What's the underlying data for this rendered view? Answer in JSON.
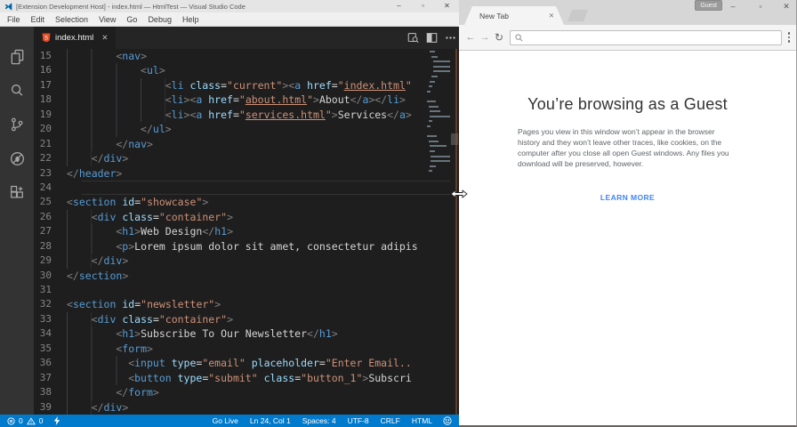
{
  "vscode": {
    "titlebar": {
      "title": "[Extension Development Host] - index.html — HtmlTest — Visual Studio Code",
      "minimize": "–",
      "maximize": "▫",
      "close": "✕"
    },
    "menubar": {
      "items": [
        "File",
        "Edit",
        "Selection",
        "View",
        "Go",
        "Debug",
        "Help"
      ]
    },
    "activitybar": {
      "items": [
        "explorer",
        "search",
        "source-control",
        "debug",
        "extensions"
      ]
    },
    "tab": {
      "label": "index.html",
      "close": "✕"
    },
    "editor": {
      "current_line": 24,
      "lines": [
        {
          "n": 15,
          "indent": 8,
          "tokens": [
            [
              "pt",
              "<"
            ],
            [
              "tg",
              "nav"
            ],
            [
              "pt",
              ">"
            ]
          ]
        },
        {
          "n": 16,
          "indent": 12,
          "tokens": [
            [
              "pt",
              "<"
            ],
            [
              "tg",
              "ul"
            ],
            [
              "pt",
              ">"
            ]
          ]
        },
        {
          "n": 17,
          "indent": 16,
          "tokens": [
            [
              "pt",
              "<"
            ],
            [
              "tg",
              "li"
            ],
            [
              "tx",
              " "
            ],
            [
              "at",
              "class"
            ],
            [
              "eq",
              "="
            ],
            [
              "st",
              "\"current\""
            ],
            [
              "pt",
              "><"
            ],
            [
              "tg",
              "a"
            ],
            [
              "tx",
              " "
            ],
            [
              "at",
              "href"
            ],
            [
              "eq",
              "="
            ],
            [
              "st",
              "\""
            ],
            [
              "ln",
              "index.html"
            ],
            [
              "st",
              "\""
            ]
          ]
        },
        {
          "n": 18,
          "indent": 16,
          "tokens": [
            [
              "pt",
              "<"
            ],
            [
              "tg",
              "li"
            ],
            [
              "pt",
              "><"
            ],
            [
              "tg",
              "a"
            ],
            [
              "tx",
              " "
            ],
            [
              "at",
              "href"
            ],
            [
              "eq",
              "="
            ],
            [
              "st",
              "\""
            ],
            [
              "ln",
              "about.html"
            ],
            [
              "st",
              "\""
            ],
            [
              "pt",
              ">"
            ],
            [
              "tx",
              "About"
            ],
            [
              "pt",
              "</"
            ],
            [
              "tg",
              "a"
            ],
            [
              "pt",
              "></"
            ],
            [
              "tg",
              "li"
            ],
            [
              "pt",
              ">"
            ]
          ]
        },
        {
          "n": 19,
          "indent": 16,
          "tokens": [
            [
              "pt",
              "<"
            ],
            [
              "tg",
              "li"
            ],
            [
              "pt",
              "><"
            ],
            [
              "tg",
              "a"
            ],
            [
              "tx",
              " "
            ],
            [
              "at",
              "href"
            ],
            [
              "eq",
              "="
            ],
            [
              "st",
              "\""
            ],
            [
              "ln",
              "services.html"
            ],
            [
              "st",
              "\""
            ],
            [
              "pt",
              ">"
            ],
            [
              "tx",
              "Services"
            ],
            [
              "pt",
              "</"
            ],
            [
              "tg",
              "a"
            ],
            [
              "pt",
              ">"
            ]
          ]
        },
        {
          "n": 20,
          "indent": 12,
          "tokens": [
            [
              "pt",
              "</"
            ],
            [
              "tg",
              "ul"
            ],
            [
              "pt",
              ">"
            ]
          ]
        },
        {
          "n": 21,
          "indent": 8,
          "tokens": [
            [
              "pt",
              "</"
            ],
            [
              "tg",
              "nav"
            ],
            [
              "pt",
              ">"
            ]
          ]
        },
        {
          "n": 22,
          "indent": 4,
          "tokens": [
            [
              "pt",
              "</"
            ],
            [
              "tg",
              "div"
            ],
            [
              "pt",
              ">"
            ]
          ]
        },
        {
          "n": 23,
          "indent": 0,
          "tokens": [
            [
              "pt",
              "</"
            ],
            [
              "tg",
              "header"
            ],
            [
              "pt",
              ">"
            ]
          ]
        },
        {
          "n": 24,
          "indent": 0,
          "tokens": []
        },
        {
          "n": 25,
          "indent": 0,
          "tokens": [
            [
              "pt",
              "<"
            ],
            [
              "tg",
              "section"
            ],
            [
              "tx",
              " "
            ],
            [
              "at",
              "id"
            ],
            [
              "eq",
              "="
            ],
            [
              "st",
              "\"showcase\""
            ],
            [
              "pt",
              ">"
            ]
          ]
        },
        {
          "n": 26,
          "indent": 4,
          "tokens": [
            [
              "pt",
              "<"
            ],
            [
              "tg",
              "div"
            ],
            [
              "tx",
              " "
            ],
            [
              "at",
              "class"
            ],
            [
              "eq",
              "="
            ],
            [
              "st",
              "\"container\""
            ],
            [
              "pt",
              ">"
            ]
          ]
        },
        {
          "n": 27,
          "indent": 8,
          "tokens": [
            [
              "pt",
              "<"
            ],
            [
              "tg",
              "h1"
            ],
            [
              "pt",
              ">"
            ],
            [
              "tx",
              "Web Design"
            ],
            [
              "pt",
              "</"
            ],
            [
              "tg",
              "h1"
            ],
            [
              "pt",
              ">"
            ]
          ]
        },
        {
          "n": 28,
          "indent": 8,
          "tokens": [
            [
              "pt",
              "<"
            ],
            [
              "tg",
              "p"
            ],
            [
              "pt",
              ">"
            ],
            [
              "tx",
              "Lorem ipsum dolor sit amet, consectetur adipis"
            ]
          ]
        },
        {
          "n": 29,
          "indent": 4,
          "tokens": [
            [
              "pt",
              "</"
            ],
            [
              "tg",
              "div"
            ],
            [
              "pt",
              ">"
            ]
          ]
        },
        {
          "n": 30,
          "indent": 0,
          "tokens": [
            [
              "pt",
              "</"
            ],
            [
              "tg",
              "section"
            ],
            [
              "pt",
              ">"
            ]
          ]
        },
        {
          "n": 31,
          "indent": 0,
          "tokens": []
        },
        {
          "n": 32,
          "indent": 0,
          "tokens": [
            [
              "pt",
              "<"
            ],
            [
              "tg",
              "section"
            ],
            [
              "tx",
              " "
            ],
            [
              "at",
              "id"
            ],
            [
              "eq",
              "="
            ],
            [
              "st",
              "\"newsletter\""
            ],
            [
              "pt",
              ">"
            ]
          ]
        },
        {
          "n": 33,
          "indent": 4,
          "tokens": [
            [
              "pt",
              "<"
            ],
            [
              "tg",
              "div"
            ],
            [
              "tx",
              " "
            ],
            [
              "at",
              "class"
            ],
            [
              "eq",
              "="
            ],
            [
              "st",
              "\"container\""
            ],
            [
              "pt",
              ">"
            ]
          ]
        },
        {
          "n": 34,
          "indent": 8,
          "tokens": [
            [
              "pt",
              "<"
            ],
            [
              "tg",
              "h1"
            ],
            [
              "pt",
              ">"
            ],
            [
              "tx",
              "Subscribe To Our Newsletter"
            ],
            [
              "pt",
              "</"
            ],
            [
              "tg",
              "h1"
            ],
            [
              "pt",
              ">"
            ]
          ]
        },
        {
          "n": 35,
          "indent": 8,
          "tokens": [
            [
              "pt",
              "<"
            ],
            [
              "tg",
              "form"
            ],
            [
              "pt",
              ">"
            ]
          ]
        },
        {
          "n": 36,
          "indent": 10,
          "tokens": [
            [
              "pt",
              "<"
            ],
            [
              "tg",
              "input"
            ],
            [
              "tx",
              " "
            ],
            [
              "at",
              "type"
            ],
            [
              "eq",
              "="
            ],
            [
              "st",
              "\"email\""
            ],
            [
              "tx",
              " "
            ],
            [
              "at",
              "placeholder"
            ],
            [
              "eq",
              "="
            ],
            [
              "st",
              "\"Enter Email.."
            ]
          ]
        },
        {
          "n": 37,
          "indent": 10,
          "tokens": [
            [
              "pt",
              "<"
            ],
            [
              "tg",
              "button"
            ],
            [
              "tx",
              " "
            ],
            [
              "at",
              "type"
            ],
            [
              "eq",
              "="
            ],
            [
              "st",
              "\"submit\""
            ],
            [
              "tx",
              " "
            ],
            [
              "at",
              "class"
            ],
            [
              "eq",
              "="
            ],
            [
              "st",
              "\"button_1\""
            ],
            [
              "pt",
              ">"
            ],
            [
              "tx",
              "Subscri"
            ]
          ]
        },
        {
          "n": 38,
          "indent": 8,
          "tokens": [
            [
              "pt",
              "</"
            ],
            [
              "tg",
              "form"
            ],
            [
              "pt",
              ">"
            ]
          ]
        },
        {
          "n": 39,
          "indent": 4,
          "tokens": [
            [
              "pt",
              "</"
            ],
            [
              "tg",
              "div"
            ],
            [
              "pt",
              ">"
            ]
          ]
        }
      ]
    },
    "statusbar": {
      "errors": "0",
      "warnings": "0",
      "right_items": [
        "Go Live",
        "Ln 24, Col 1",
        "Spaces: 4",
        "UTF-8",
        "CRLF",
        "HTML"
      ]
    }
  },
  "browser": {
    "tab": {
      "label": "New Tab",
      "close": "✕"
    },
    "titlebar": {
      "guest_badge": "Guest",
      "minimize": "–",
      "maximize": "▫",
      "close": "✕"
    },
    "toolbar": {
      "back": "←",
      "forward": "→",
      "refresh": "↻",
      "address_value": ""
    },
    "page": {
      "heading": "You’re browsing as a Guest",
      "body": "Pages you view in this window won’t appear in the browser history and they won’t leave other traces, like cookies, on the computer after you close all open Guest windows. Any files you download will be preserved, however.",
      "link": "LEARN MORE"
    }
  },
  "colors": {
    "status_bar": "#007acc",
    "editor_bg": "#1e1e1e",
    "tag": "#569cd6",
    "attribute": "#9cdcfe",
    "string": "#ce9178",
    "link_blue": "#4285f4",
    "html_icon_orange": "#e44d26"
  }
}
